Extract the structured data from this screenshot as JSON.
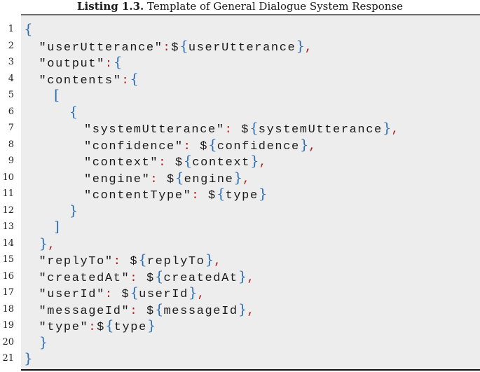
{
  "caption": {
    "label": "Listing 1.3.",
    "title": " Template of General Dialogue System Response"
  },
  "colors": {
    "brace": "#2f6fb3",
    "punctuation": "#b01818",
    "text": "#1a1a1a",
    "background": "#ededed"
  },
  "lines": [
    {
      "n": "1",
      "indent": 0,
      "tokens": [
        [
          "b",
          "{"
        ]
      ]
    },
    {
      "n": "2",
      "indent": 1,
      "tokens": [
        [
          "t",
          "\"userUtterance\""
        ],
        [
          "p",
          ":"
        ],
        [
          "t",
          "$"
        ],
        [
          "b",
          "{"
        ],
        [
          "t",
          "userUtterance"
        ],
        [
          "b",
          "}"
        ],
        [
          "p",
          ","
        ]
      ]
    },
    {
      "n": "3",
      "indent": 1,
      "tokens": [
        [
          "t",
          "\"output\""
        ],
        [
          "p",
          ":"
        ],
        [
          "b",
          "{"
        ]
      ]
    },
    {
      "n": "4",
      "indent": 1,
      "tokens": [
        [
          "t",
          "\"contents\""
        ],
        [
          "p",
          ":"
        ],
        [
          "b",
          "{"
        ]
      ]
    },
    {
      "n": "5",
      "indent": 2,
      "tokens": [
        [
          "b",
          "["
        ]
      ]
    },
    {
      "n": "6",
      "indent": 3,
      "tokens": [
        [
          "b",
          "{"
        ]
      ]
    },
    {
      "n": "7",
      "indent": 4,
      "tokens": [
        [
          "t",
          "\"systemUtterance\""
        ],
        [
          "p",
          ":"
        ],
        [
          "t",
          " $"
        ],
        [
          "b",
          "{"
        ],
        [
          "t",
          "systemUtterance"
        ],
        [
          "b",
          "}"
        ],
        [
          "p",
          ","
        ]
      ]
    },
    {
      "n": "8",
      "indent": 4,
      "tokens": [
        [
          "t",
          "\"confidence\""
        ],
        [
          "p",
          ":"
        ],
        [
          "t",
          " $"
        ],
        [
          "b",
          "{"
        ],
        [
          "t",
          "confidence"
        ],
        [
          "b",
          "}"
        ],
        [
          "p",
          ","
        ]
      ]
    },
    {
      "n": "9",
      "indent": 4,
      "tokens": [
        [
          "t",
          "\"context\""
        ],
        [
          "p",
          ":"
        ],
        [
          "t",
          " $"
        ],
        [
          "b",
          "{"
        ],
        [
          "t",
          "context"
        ],
        [
          "b",
          "}"
        ],
        [
          "p",
          ","
        ]
      ]
    },
    {
      "n": "10",
      "indent": 4,
      "tokens": [
        [
          "t",
          "\"engine\""
        ],
        [
          "p",
          ":"
        ],
        [
          "t",
          " $"
        ],
        [
          "b",
          "{"
        ],
        [
          "t",
          "engine"
        ],
        [
          "b",
          "}"
        ],
        [
          "p",
          ","
        ]
      ]
    },
    {
      "n": "11",
      "indent": 4,
      "tokens": [
        [
          "t",
          "\"contentType\""
        ],
        [
          "p",
          ":"
        ],
        [
          "t",
          " $"
        ],
        [
          "b",
          "{"
        ],
        [
          "t",
          "type"
        ],
        [
          "b",
          "}"
        ]
      ]
    },
    {
      "n": "12",
      "indent": 3,
      "tokens": [
        [
          "b",
          "}"
        ]
      ]
    },
    {
      "n": "13",
      "indent": 2,
      "tokens": [
        [
          "b",
          "]"
        ]
      ]
    },
    {
      "n": "14",
      "indent": 1,
      "tokens": [
        [
          "b",
          "}"
        ],
        [
          "p",
          ","
        ]
      ]
    },
    {
      "n": "15",
      "indent": 1,
      "tokens": [
        [
          "t",
          "\"replyTo\""
        ],
        [
          "p",
          ":"
        ],
        [
          "t",
          " $"
        ],
        [
          "b",
          "{"
        ],
        [
          "t",
          "replyTo"
        ],
        [
          "b",
          "}"
        ],
        [
          "p",
          ","
        ]
      ]
    },
    {
      "n": "16",
      "indent": 1,
      "tokens": [
        [
          "t",
          "\"createdAt\""
        ],
        [
          "p",
          ":"
        ],
        [
          "t",
          " $"
        ],
        [
          "b",
          "{"
        ],
        [
          "t",
          "createdAt"
        ],
        [
          "b",
          "}"
        ],
        [
          "p",
          ","
        ]
      ]
    },
    {
      "n": "17",
      "indent": 1,
      "tokens": [
        [
          "t",
          "\"userId\""
        ],
        [
          "p",
          ":"
        ],
        [
          "t",
          " $"
        ],
        [
          "b",
          "{"
        ],
        [
          "t",
          "userId"
        ],
        [
          "b",
          "}"
        ],
        [
          "p",
          ","
        ]
      ]
    },
    {
      "n": "18",
      "indent": 1,
      "tokens": [
        [
          "t",
          "\"messageId\""
        ],
        [
          "p",
          ":"
        ],
        [
          "t",
          " $"
        ],
        [
          "b",
          "{"
        ],
        [
          "t",
          "messageId"
        ],
        [
          "b",
          "}"
        ],
        [
          "p",
          ","
        ]
      ]
    },
    {
      "n": "19",
      "indent": 1,
      "tokens": [
        [
          "t",
          "\"type\""
        ],
        [
          "p",
          ":"
        ],
        [
          "t",
          "$"
        ],
        [
          "b",
          "{"
        ],
        [
          "t",
          "type"
        ],
        [
          "b",
          "}"
        ]
      ]
    },
    {
      "n": "20",
      "indent": 1,
      "tokens": [
        [
          "b",
          "}"
        ]
      ]
    },
    {
      "n": "21",
      "indent": 0,
      "tokens": [
        [
          "b",
          "}"
        ]
      ]
    }
  ]
}
